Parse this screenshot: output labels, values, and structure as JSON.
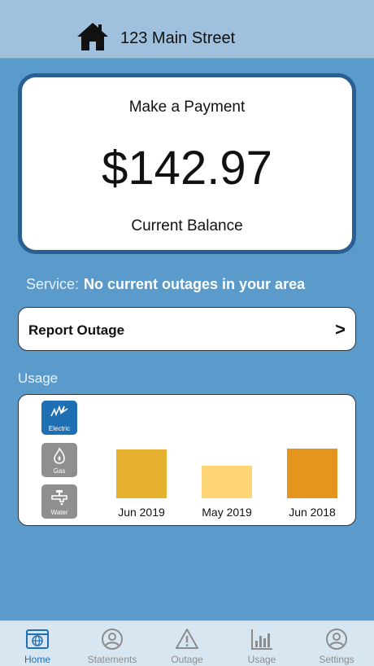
{
  "header": {
    "address": "123 Main Street",
    "icon": "home-icon"
  },
  "payment": {
    "title": "Make a Payment",
    "amount": "$142.97",
    "label": "Current Balance"
  },
  "service": {
    "label": "Service:",
    "status": "No current outages in your area"
  },
  "outage_button": {
    "label": "Report Outage",
    "arrow": ">"
  },
  "usage": {
    "title": "Usage",
    "utilities": [
      {
        "label": "Electric",
        "icon": "electric-icon",
        "selected": true,
        "color": "#1f6fb5"
      },
      {
        "label": "Gas",
        "icon": "gas-flame-icon",
        "selected": false,
        "color": "#8f8f8f"
      },
      {
        "label": "Water",
        "icon": "water-faucet-icon",
        "selected": false,
        "color": "#8f8f8f"
      }
    ],
    "chart_data": {
      "type": "bar",
      "categories": [
        "Jun 2019",
        "May 2019",
        "Jun 2018"
      ],
      "values": [
        60,
        40,
        61
      ],
      "colors": [
        "#e5b12e",
        "#fdd574",
        "#e4951e"
      ],
      "title": "",
      "xlabel": "",
      "ylabel": ""
    }
  },
  "tabs": [
    {
      "label": "Home",
      "icon": "home-globe-icon",
      "active": true
    },
    {
      "label": "Statements",
      "icon": "person-circle-icon",
      "active": false
    },
    {
      "label": "Outage",
      "icon": "warning-triangle-icon",
      "active": false
    },
    {
      "label": "Usage",
      "icon": "bar-chart-icon",
      "active": false
    },
    {
      "label": "Settings",
      "icon": "person-circle-icon",
      "active": false
    }
  ],
  "colors": {
    "background": "#5a9bcb",
    "header": "#9fc1dd",
    "card_border": "#2a5f93",
    "accent": "#1f6fb5"
  }
}
